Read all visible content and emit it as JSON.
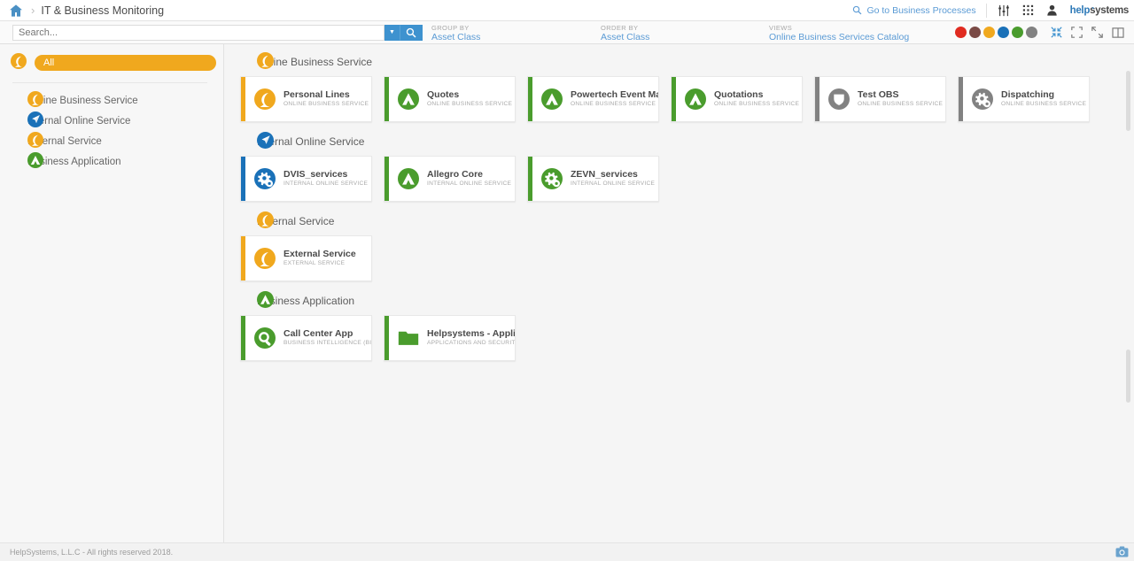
{
  "header": {
    "home_icon": "home-icon",
    "separator": "›",
    "title": "IT & Business Monitoring",
    "go_to_business_processes": "Go to Business Processes",
    "search_icon": "search-icon",
    "sliders_icon": "sliders-icon",
    "grid_icon": "grid-apps-icon",
    "user_icon": "user-account-icon",
    "logo_primary": "help",
    "logo_secondary": "systems",
    "logo_mark": "◔"
  },
  "toolbar": {
    "search_value": "",
    "search_placeholder": "Search...",
    "dropdown_caret": "▼",
    "search_button_icon": "search-icon",
    "group_by_label": "GROUP BY",
    "group_by_value": "Asset Class",
    "order_by_label": "ORDER BY",
    "order_by_value": "Asset Class",
    "views_label": "VIEWS",
    "views_value": "Online Business Services Catalog",
    "status_dots": [
      {
        "name": "status-dot-critical",
        "color": "#e02b20"
      },
      {
        "name": "status-dot-major",
        "color": "#7a4a45"
      },
      {
        "name": "status-dot-warning",
        "color": "#f0a81e"
      },
      {
        "name": "status-dot-info",
        "color": "#1a71b8"
      },
      {
        "name": "status-dot-ok",
        "color": "#4a9c2d"
      },
      {
        "name": "status-dot-unknown",
        "color": "#828282"
      }
    ],
    "icons": [
      {
        "name": "collapse-arrows-icon"
      },
      {
        "name": "fit-screen-icon"
      },
      {
        "name": "expand-arrows-icon"
      },
      {
        "name": "split-panel-icon"
      }
    ]
  },
  "sidebar": {
    "all_label": "All",
    "all_badge": "badge-moon-orange",
    "items": [
      {
        "label": "Online Business Service",
        "badge": "badge-moon-orange",
        "color": "#f0a81e",
        "glyph": "moon"
      },
      {
        "label": "Internal Online Service",
        "badge": "badge-arrow-blue",
        "color": "#1a71b8",
        "glyph": "arrow"
      },
      {
        "label": "External Service",
        "badge": "badge-moon-orange",
        "color": "#f0a81e",
        "glyph": "moon"
      },
      {
        "label": "Business Application",
        "badge": "badge-peak-green",
        "color": "#4a9c2d",
        "glyph": "peak"
      }
    ]
  },
  "main": {
    "groups": [
      {
        "title": "Online Business Service",
        "badge_color": "#f0a81e",
        "badge_glyph": "moon",
        "cards": [
          {
            "title": "Personal Lines",
            "subtitle": "ONLINE BUSINESS SERVICE",
            "accent": "#f0a81e",
            "icon_color": "#f0a81e",
            "glyph": "moon"
          },
          {
            "title": "Quotes",
            "subtitle": "ONLINE BUSINESS SERVICE",
            "accent": "#4a9c2d",
            "icon_color": "#4a9c2d",
            "glyph": "peak"
          },
          {
            "title": "Powertech Event Ma…",
            "subtitle": "ONLINE BUSINESS SERVICE",
            "accent": "#4a9c2d",
            "icon_color": "#4a9c2d",
            "glyph": "peak"
          },
          {
            "title": "Quotations",
            "subtitle": "ONLINE BUSINESS SERVICE",
            "accent": "#4a9c2d",
            "icon_color": "#4a9c2d",
            "glyph": "peak"
          },
          {
            "title": "Test OBS",
            "subtitle": "ONLINE BUSINESS SERVICE",
            "accent": "#828282",
            "icon_color": "#828282",
            "glyph": "shield"
          },
          {
            "title": "Dispatching",
            "subtitle": "ONLINE BUSINESS SERVICE",
            "accent": "#828282",
            "icon_color": "#828282",
            "glyph": "gears"
          }
        ]
      },
      {
        "title": "Internal Online Service",
        "badge_color": "#1a71b8",
        "badge_glyph": "arrow",
        "cards": [
          {
            "title": "DVIS_services",
            "subtitle": "INTERNAL ONLINE SERVICE",
            "accent": "#1a71b8",
            "icon_color": "#1a71b8",
            "glyph": "gears"
          },
          {
            "title": "Allegro Core",
            "subtitle": "INTERNAL ONLINE SERVICE",
            "accent": "#4a9c2d",
            "icon_color": "#4a9c2d",
            "glyph": "peak"
          },
          {
            "title": "ZEVN_services",
            "subtitle": "INTERNAL ONLINE SERVICE",
            "accent": "#4a9c2d",
            "icon_color": "#4a9c2d",
            "glyph": "gears"
          }
        ]
      },
      {
        "title": "External Service",
        "badge_color": "#f0a81e",
        "badge_glyph": "moon",
        "cards": [
          {
            "title": "External Service",
            "subtitle": "EXTERNAL SERVICE",
            "accent": "#f0a81e",
            "icon_color": "#f0a81e",
            "glyph": "moon"
          }
        ]
      },
      {
        "title": "Business Application",
        "badge_color": "#4a9c2d",
        "badge_glyph": "peak",
        "cards": [
          {
            "title": "Call Center App",
            "subtitle": "BUSINESS INTELLIGENCE (BI)",
            "accent": "#4a9c2d",
            "icon_color": "#4a9c2d",
            "glyph": "magnifier"
          },
          {
            "title": "Helpsystems - Appli…",
            "subtitle": "APPLICATIONS AND SECURITY …",
            "accent": "#4a9c2d",
            "icon_color": "#4a9c2d",
            "glyph": "folder"
          }
        ]
      }
    ]
  },
  "footer": {
    "copyright": "HelpSystems, L.L.C - All rights reserved 2018.",
    "camera_icon": "screenshot-camera-icon"
  }
}
